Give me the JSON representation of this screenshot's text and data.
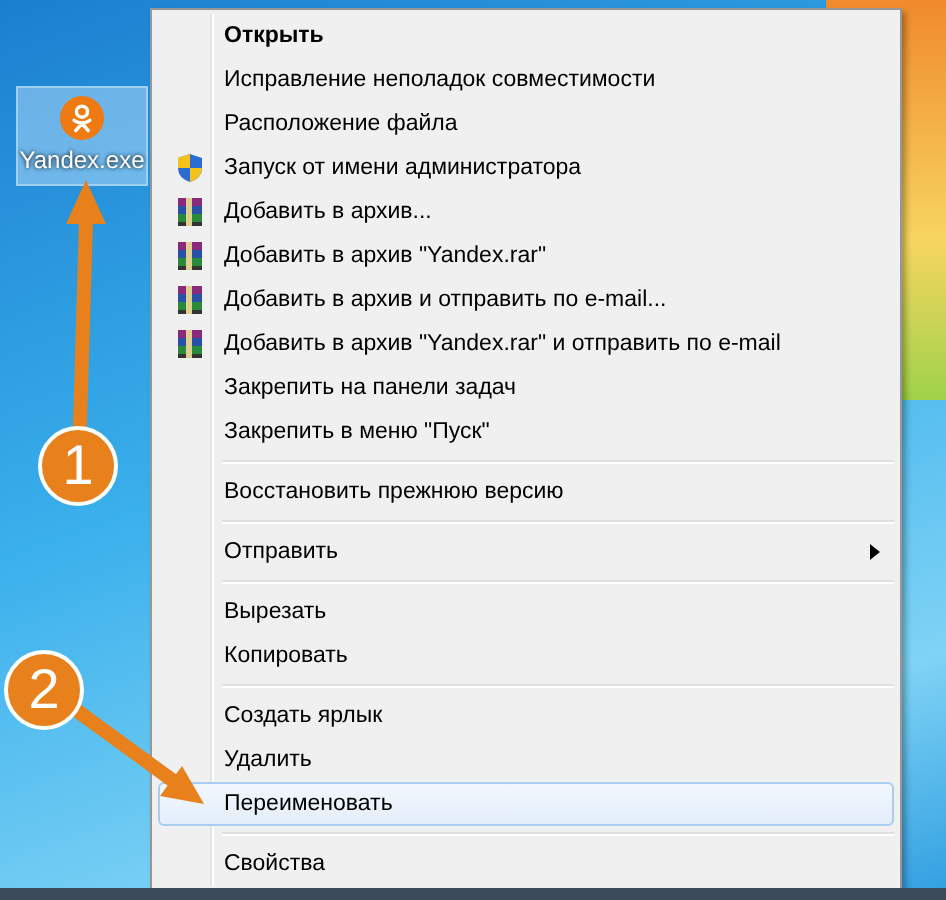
{
  "desktop_icon": {
    "label": "Yandex.exe",
    "selected": true
  },
  "context_menu": {
    "items": [
      {
        "kind": "item",
        "label": "Открыть",
        "default": true,
        "submenu": false,
        "selected": false
      },
      {
        "kind": "item",
        "label": "Исправление неполадок совместимости",
        "default": false,
        "submenu": false,
        "selected": false
      },
      {
        "kind": "item",
        "label": "Расположение файла",
        "default": false,
        "submenu": false,
        "selected": false
      },
      {
        "kind": "shield_item",
        "label": "Запуск от имени администратора",
        "default": false,
        "submenu": false,
        "selected": false
      },
      {
        "kind": "archive_item",
        "label": "Добавить в архив...",
        "default": false,
        "submenu": false,
        "selected": false
      },
      {
        "kind": "archive_item",
        "label": "Добавить в архив \"Yandex.rar\"",
        "default": false,
        "submenu": false,
        "selected": false
      },
      {
        "kind": "archive_item",
        "label": "Добавить в архив и отправить по e-mail...",
        "default": false,
        "submenu": false,
        "selected": false
      },
      {
        "kind": "archive_item",
        "label": "Добавить в архив \"Yandex.rar\" и отправить по e-mail",
        "default": false,
        "submenu": false,
        "selected": false
      },
      {
        "kind": "item",
        "label": "Закрепить на панели задач",
        "default": false,
        "submenu": false,
        "selected": false
      },
      {
        "kind": "item",
        "label": "Закрепить в меню \"Пуск\"",
        "default": false,
        "submenu": false,
        "selected": false
      },
      {
        "kind": "separator"
      },
      {
        "kind": "item",
        "label": "Восстановить прежнюю версию",
        "default": false,
        "submenu": false,
        "selected": false
      },
      {
        "kind": "separator"
      },
      {
        "kind": "item",
        "label": "Отправить",
        "default": false,
        "submenu": true,
        "selected": false
      },
      {
        "kind": "separator"
      },
      {
        "kind": "item",
        "label": "Вырезать",
        "default": false,
        "submenu": false,
        "selected": false
      },
      {
        "kind": "item",
        "label": "Копировать",
        "default": false,
        "submenu": false,
        "selected": false
      },
      {
        "kind": "separator"
      },
      {
        "kind": "item",
        "label": "Создать ярлык",
        "default": false,
        "submenu": false,
        "selected": false
      },
      {
        "kind": "item",
        "label": "Удалить",
        "default": false,
        "submenu": false,
        "selected": false
      },
      {
        "kind": "item",
        "label": "Переименовать",
        "default": false,
        "submenu": false,
        "selected": true
      },
      {
        "kind": "separator"
      },
      {
        "kind": "item",
        "label": "Свойства",
        "default": false,
        "submenu": false,
        "selected": false
      }
    ]
  },
  "callouts": [
    {
      "number": "1"
    },
    {
      "number": "2"
    }
  ]
}
